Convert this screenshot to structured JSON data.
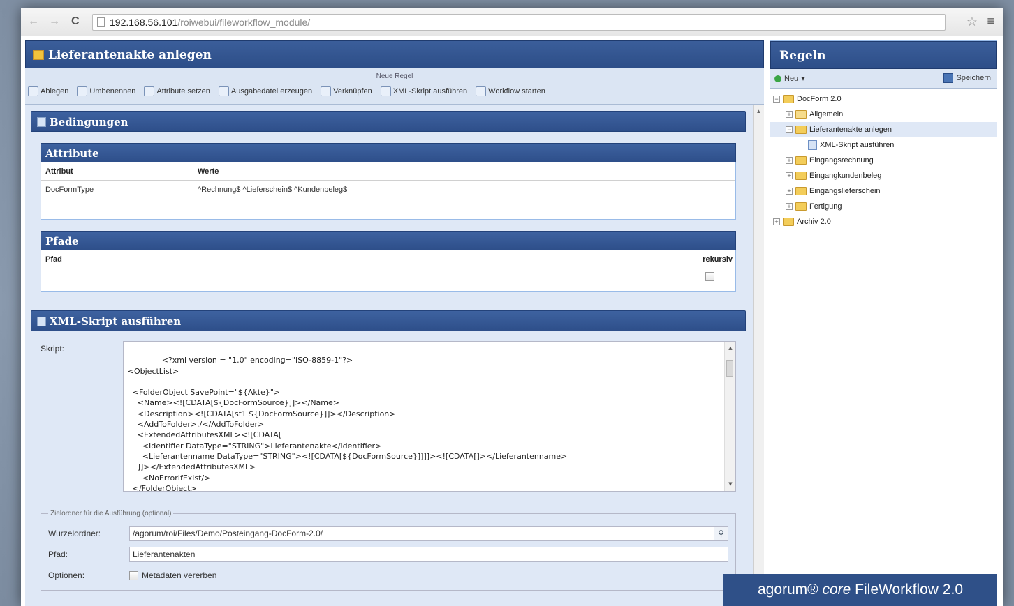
{
  "browser": {
    "url_host": "192.168.56.101",
    "url_path": "/roiwebui/fileworkflow_module/"
  },
  "left_panel": {
    "title": "Lieferantenakte anlegen",
    "toolbar": {
      "title": "Neue Regel",
      "items": [
        {
          "label": "Ablegen",
          "icon": "ablegen-icon"
        },
        {
          "label": "Umbenennen",
          "icon": "umbenennen-icon"
        },
        {
          "label": "Attribute setzen",
          "icon": "attribute-icon"
        },
        {
          "label": "Ausgabedatei erzeugen",
          "icon": "ausgabedatei-icon"
        },
        {
          "label": "Verknüpfen",
          "icon": "verknuepfen-icon"
        },
        {
          "label": "XML-Skript ausführen",
          "icon": "xml-icon"
        },
        {
          "label": "Workflow starten",
          "icon": "workflow-icon"
        }
      ]
    },
    "bedingungen": {
      "title": "Bedingungen",
      "attribute": {
        "title": "Attribute",
        "columns": [
          "Attribut",
          "Werte"
        ],
        "rows": [
          {
            "attribut": "DocFormType",
            "werte": "^Rechnung$ ^Lieferschein$ ^Kundenbeleg$"
          }
        ]
      },
      "pfade": {
        "title": "Pfade",
        "columns": [
          "Pfad",
          "rekursiv"
        ],
        "rekursiv_checked": false
      }
    },
    "xml_skript": {
      "title": "XML-Skript ausführen",
      "skript_label": "Skript:",
      "skript_value": "<?xml version = \"1.0\" encoding=\"ISO-8859-1\"?>\n<ObjectList>\n\n  <FolderObject SavePoint=\"${Akte}\">\n    <Name><![CDATA[${DocFormSource}]]></Name>\n    <Description><![CDATA[sf1 ${DocFormSource}]]></Description>\n    <AddToFolder>./</AddToFolder>\n    <ExtendedAttributesXML><![CDATA[\n      <Identifier DataType=\"STRING\">Lieferantenakte</Identifier>\n      <Lieferantenname DataType=\"STRING\"><![CDATA[${DocFormSource}]]]]><![CDATA[]></Lieferantenname>\n    ]]></ExtendedAttributesXML>\n      <NoErrorIfExist/>\n  </FolderObject>",
      "zielordner": {
        "legend": "Zielordner für die Ausführung (optional)",
        "wurzelordner_label": "Wurzelordner:",
        "wurzelordner_value": "/agorum/roi/Files/Demo/Posteingang-DocForm-2.0/",
        "pfad_label": "Pfad:",
        "pfad_value": "Lieferantenakten",
        "optionen_label": "Optionen:",
        "metadaten_label": "Metadaten vererben",
        "metadaten_checked": false
      }
    }
  },
  "right_panel": {
    "title": "Regeln",
    "neu_label": "Neu",
    "speichern_label": "Speichern",
    "tree": [
      {
        "label": "DocForm 2.0",
        "level": 0,
        "expanded": true,
        "type": "folder"
      },
      {
        "label": "Allgemein",
        "level": 1,
        "expanded": false,
        "type": "folder-plain"
      },
      {
        "label": "Lieferantenakte anlegen",
        "level": 1,
        "expanded": true,
        "type": "folder",
        "selected": true
      },
      {
        "label": "XML-Skript ausführen",
        "level": 2,
        "type": "script"
      },
      {
        "label": "Eingangsrechnung",
        "level": 1,
        "expanded": false,
        "type": "folder"
      },
      {
        "label": "Eingangkundenbeleg",
        "level": 1,
        "expanded": false,
        "type": "folder"
      },
      {
        "label": "Eingangslieferschein",
        "level": 1,
        "expanded": false,
        "type": "folder"
      },
      {
        "label": "Fertigung",
        "level": 1,
        "expanded": false,
        "type": "folder"
      },
      {
        "label": "Archiv 2.0",
        "level": 0,
        "expanded": false,
        "type": "folder"
      }
    ]
  },
  "watermark": {
    "brand": "agorum® ",
    "core": "core",
    "product": " FileWorkflow 2.0"
  },
  "colors": {
    "header_blue": "#2d4e88",
    "panel_bg": "#dfe8f6"
  }
}
